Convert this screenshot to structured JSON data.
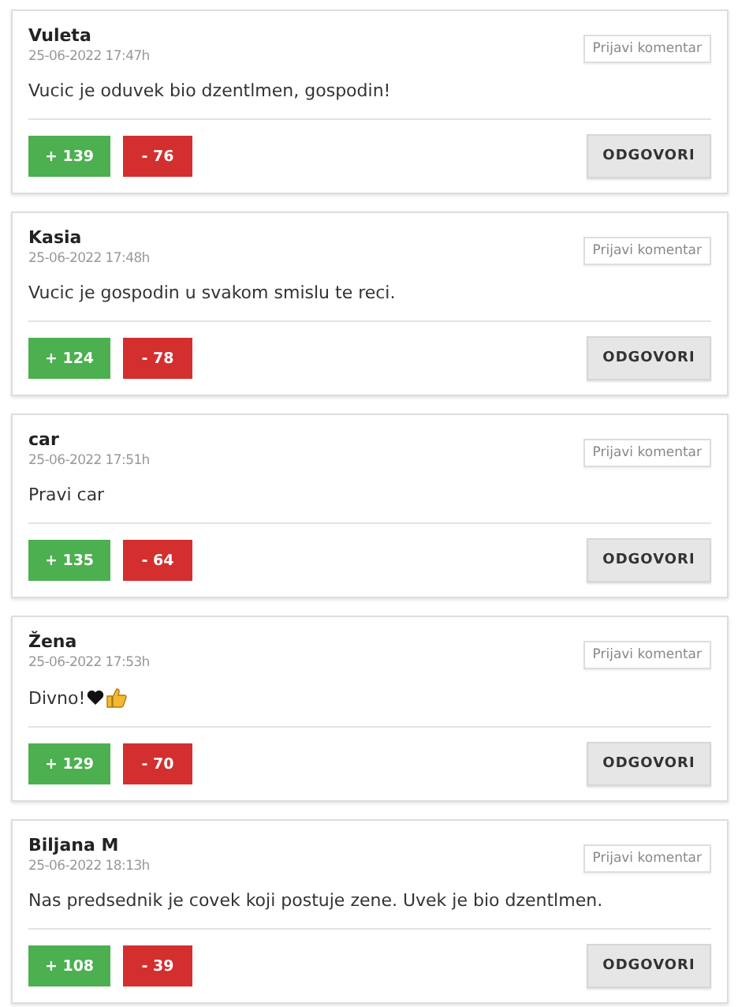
{
  "comments": [
    {
      "author": "Vuleta",
      "date": "25-06-2022 17:47h",
      "text": "Vucic je oduvek bio dzentlmen, gospodin!",
      "kind": "plain",
      "report": "Prijavi komentar",
      "likes": "+ 139",
      "dislikes": "- 76",
      "reply": "ODGOVORI"
    },
    {
      "author": "Kasia",
      "date": "25-06-2022 17:48h",
      "text": "Vucic je gospodin u svakom smislu te reci.",
      "kind": "plain",
      "report": "Prijavi komentar",
      "likes": "+ 124",
      "dislikes": "- 78",
      "reply": "ODGOVORI"
    },
    {
      "author": "car",
      "date": "25-06-2022 17:51h",
      "text": "Pravi car",
      "kind": "plain",
      "report": "Prijavi komentar",
      "likes": "+ 135",
      "dislikes": "- 64",
      "reply": "ODGOVORI"
    },
    {
      "author": "Žena",
      "date": "25-06-2022 17:53h",
      "text": "Divno!",
      "kind": "emoji",
      "report": "Prijavi komentar",
      "likes": "+ 129",
      "dislikes": "- 70",
      "reply": "ODGOVORI"
    },
    {
      "author": "Biljana M",
      "date": "25-06-2022 18:13h",
      "text": "Nas predsednik je covek koji postuje zene. Uvek je bio dzentlmen.",
      "kind": "plain",
      "report": "Prijavi komentar",
      "likes": "+ 108",
      "dislikes": "- 39",
      "reply": "ODGOVORI"
    }
  ]
}
